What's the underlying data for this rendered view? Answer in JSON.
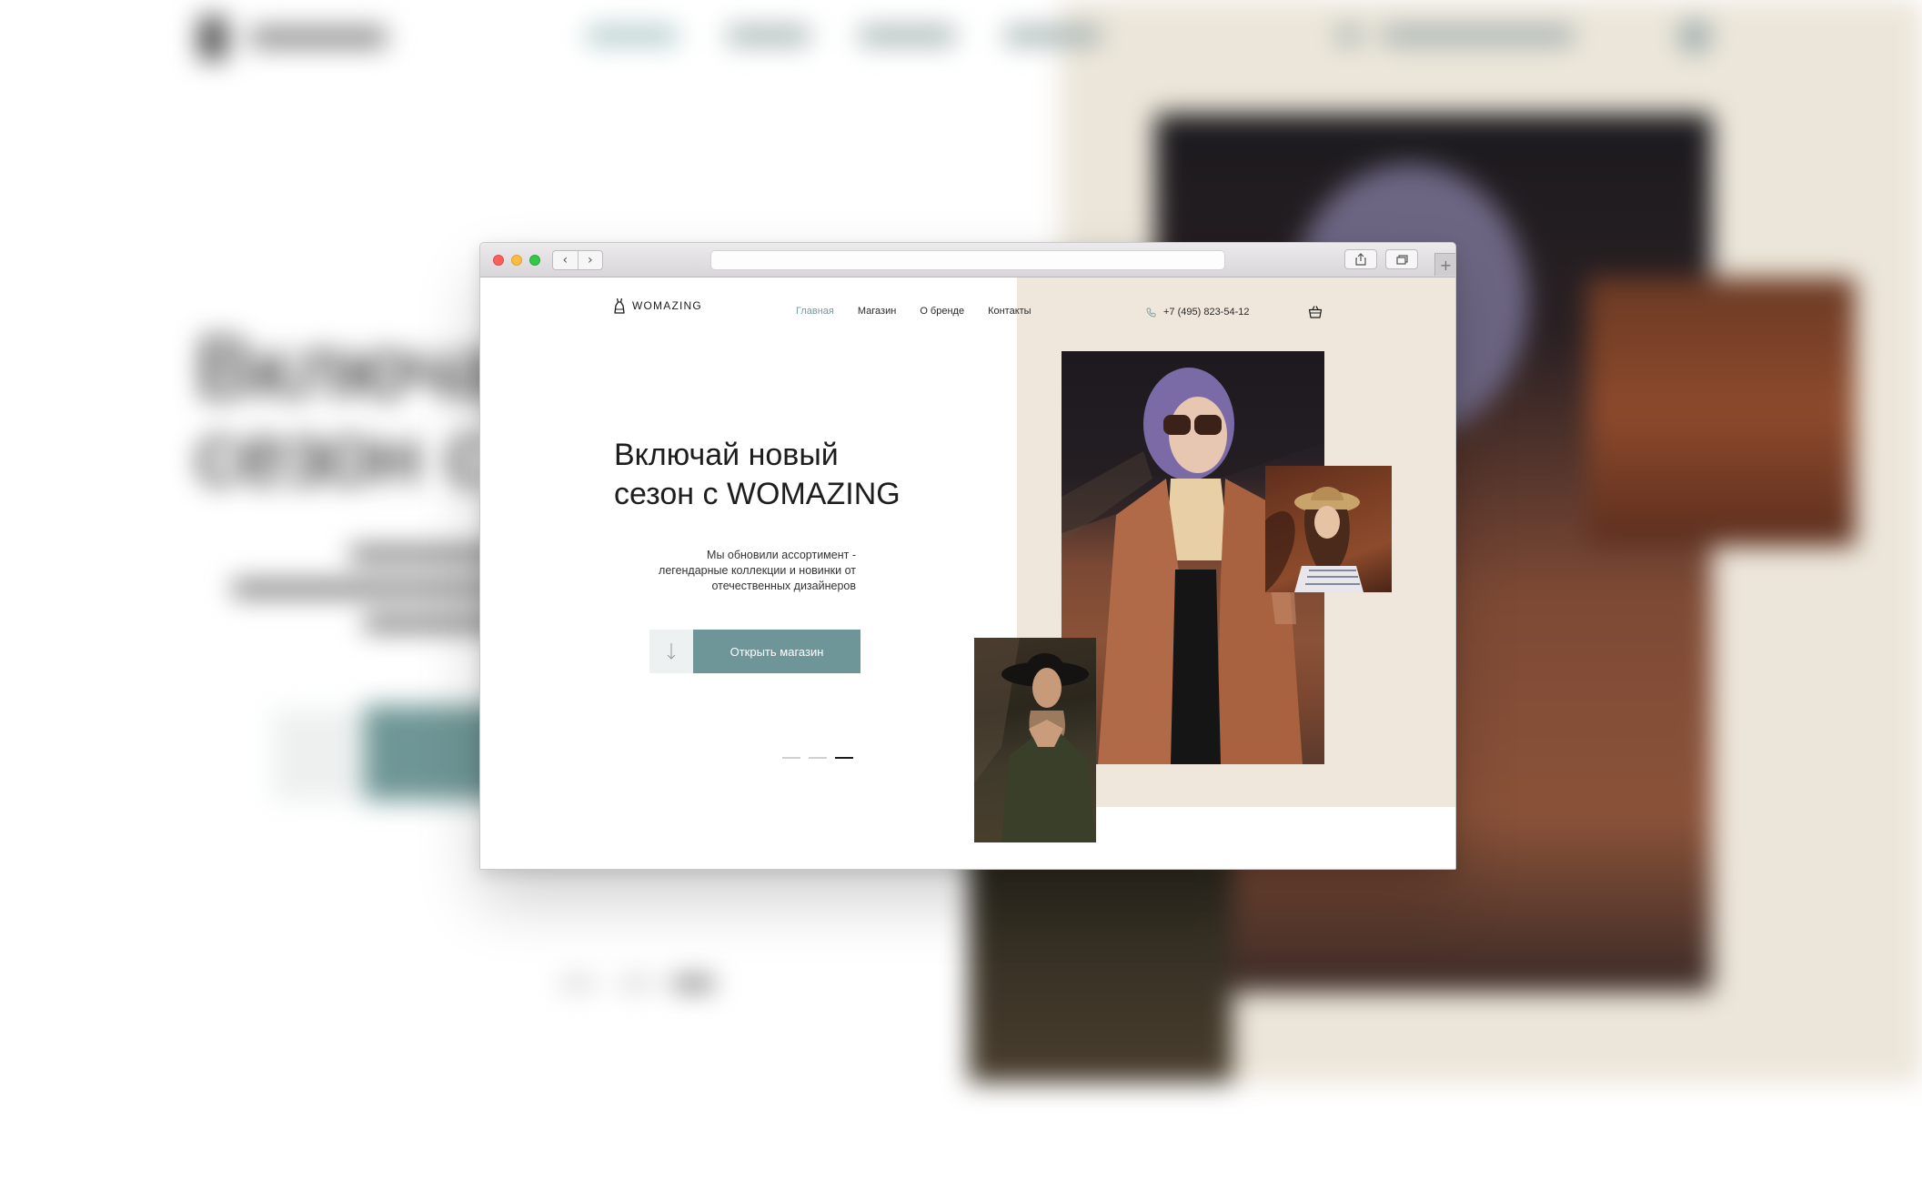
{
  "site": {
    "logo_text": "WOMAZING",
    "nav": [
      {
        "label": "Главная",
        "active": true
      },
      {
        "label": "Магазин",
        "active": false
      },
      {
        "label": "О бренде",
        "active": false
      },
      {
        "label": "Контакты",
        "active": false
      }
    ],
    "phone": "+7 (495) 823-54-12",
    "hero": {
      "title_line1": "Включай новый",
      "title_line2": "сезон с WOMAZING",
      "subtitle_line1": "Мы обновили ассортимент -",
      "subtitle_line2": "легендарные коллекции и новинки от",
      "subtitle_line3": "отечественных дизайнеров",
      "button_label": "Открыть магазин"
    },
    "slider": {
      "count": 3,
      "active_index": 2
    }
  },
  "colors": {
    "accent": "#6e9598",
    "nav_active": "#6e9c9f",
    "beige": "#efe7db",
    "text": "#1d1d1d"
  },
  "icons": {
    "logo": "dress-icon",
    "phone": "phone-icon",
    "cart": "cart-icon",
    "cta_arrow": "arrow-down-icon",
    "browser_back": "chevron-left-icon",
    "browser_forward": "chevron-right-icon",
    "share": "share-icon",
    "tabs": "tabs-icon",
    "new_tab": "plus-icon"
  }
}
